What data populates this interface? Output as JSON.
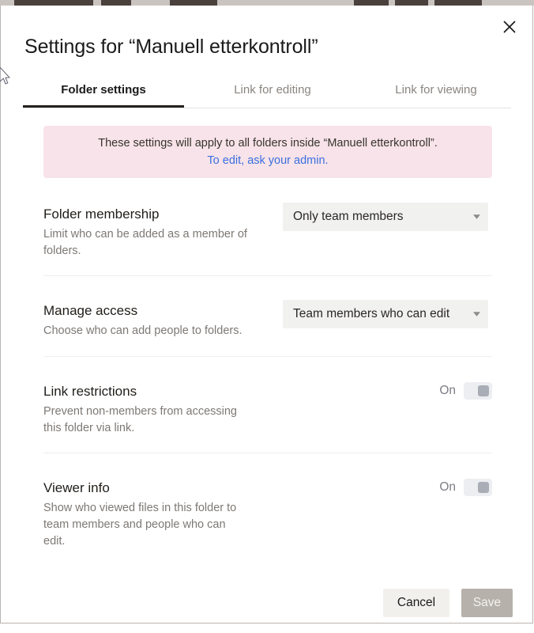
{
  "window": {
    "close_icon": "close-icon"
  },
  "modal": {
    "title": "Settings for “Manuell etterkontroll”"
  },
  "tabs": [
    {
      "label": "Folder settings",
      "active": true
    },
    {
      "label": "Link for editing",
      "active": false
    },
    {
      "label": "Link for viewing",
      "active": false
    }
  ],
  "notice": {
    "text": "These settings will apply to all folders inside “Manuell etterkontroll”.",
    "link": "To edit, ask your admin.",
    "background_color": "#f7e3e9",
    "link_color": "#3b6fe0"
  },
  "settings": [
    {
      "label": "Folder membership",
      "description": "Limit who can be added as a member of folders.",
      "control": "dropdown",
      "value": "Only team members"
    },
    {
      "label": "Manage access",
      "description": "Choose who can add people to folders.",
      "control": "dropdown",
      "value": "Team members who can edit"
    },
    {
      "label": "Link restrictions",
      "description": "Prevent non-members from accessing this folder via link.",
      "control": "toggle",
      "value": "On"
    },
    {
      "label": "Viewer info",
      "description": "Show who viewed files in this folder to team members and people who can edit.",
      "control": "toggle",
      "value": "On"
    }
  ],
  "footer": {
    "cancel_label": "Cancel",
    "save_label": "Save",
    "save_disabled": true,
    "save_color": "#b6b1ab",
    "cancel_color": "#f2f0ed"
  }
}
